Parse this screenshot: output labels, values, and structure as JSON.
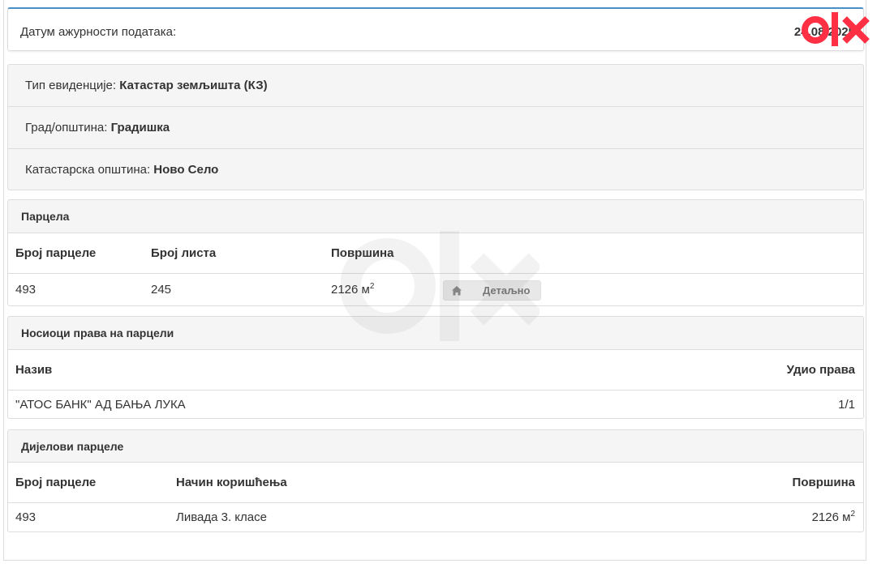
{
  "date_panel": {
    "label": "Датум ажурности података:",
    "value": "24.08.2025"
  },
  "info": {
    "rows": [
      {
        "label": "Тип евиденције: ",
        "value": "Катастар земљишта (КЗ)"
      },
      {
        "label": "Град/општина: ",
        "value": "Градишка"
      },
      {
        "label": "Катастарска општина: ",
        "value": "Ново Село"
      }
    ]
  },
  "parcel": {
    "title": "Парцела",
    "headers": [
      "Број парцеле",
      "Број листа",
      "Површина"
    ],
    "row": {
      "parcel_no": "493",
      "sheet_no": "245",
      "area": "2126 м",
      "area_unit_sup": "2"
    },
    "detail_button": "Детаљно"
  },
  "holders": {
    "title": "Носиоци права на парцели",
    "headers": [
      "Назив",
      "Удио права"
    ],
    "row": {
      "name": "\"АТОС БАНК\" АД БАЊА ЛУКА",
      "share": "1/1"
    }
  },
  "parts": {
    "title": "Дијелови парцеле",
    "headers": [
      "Број парцеле",
      "Начин коришћења",
      "Површина"
    ],
    "row": {
      "parcel_no": "493",
      "usage": "Ливада 3. класе",
      "area": "2126 м",
      "area_unit_sup": "2"
    }
  },
  "brand": {
    "logo_text": "olx",
    "logo_color": "#ff2f44"
  },
  "colors": {
    "border": "#dddddd",
    "panel_bg": "#f5f5f5",
    "accent": "#4a90c8"
  },
  "icons": {
    "detail_button_icon": "home-icon"
  }
}
